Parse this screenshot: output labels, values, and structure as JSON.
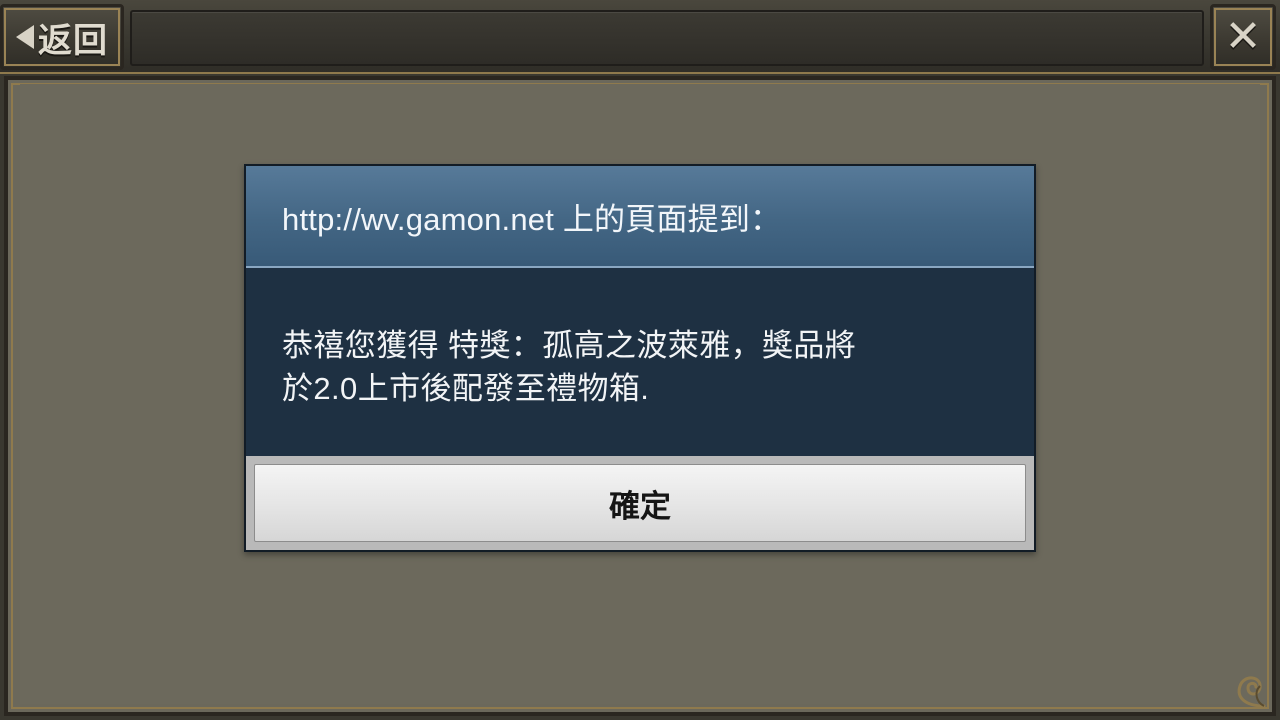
{
  "topbar": {
    "back_label": "返回",
    "back_icon": "triangle-left-icon",
    "close_icon": "close-x-icon"
  },
  "dialog": {
    "title": "http://wv.gamon.net 上的頁面提到：",
    "message_line1": "恭禧您獲得 特獎：孤高之波萊雅，獎品將",
    "message_line2": "於2.0上市後配發至禮物箱.",
    "ok_label": "確定"
  },
  "colors": {
    "dialog_header": "#436684",
    "dialog_body": "#1e3042",
    "panel_bg": "#6c695c",
    "frame_gold": "#8f7a4d"
  }
}
